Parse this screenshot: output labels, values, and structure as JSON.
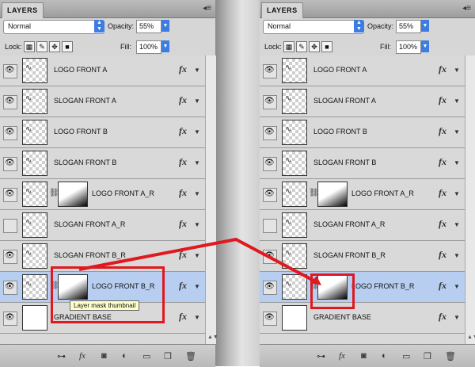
{
  "panel_left": {
    "tab": "LAYERS",
    "blend_mode": "Normal",
    "opacity_label": "Opacity:",
    "opacity_value": "55%",
    "lock_label": "Lock:",
    "fill_label": "Fill:",
    "fill_value": "100%",
    "layers": [
      {
        "name": "LOGO FRONT A",
        "visible": true,
        "mask": false,
        "selected": false,
        "checker": true
      },
      {
        "name": "SLOGAN FRONT A",
        "visible": true,
        "mask": false,
        "selected": false,
        "checker": true
      },
      {
        "name": "LOGO FRONT B",
        "visible": true,
        "mask": false,
        "selected": false,
        "checker": true
      },
      {
        "name": "SLOGAN FRONT B",
        "visible": true,
        "mask": false,
        "selected": false,
        "checker": true
      },
      {
        "name": "LOGO FRONT A_R",
        "visible": true,
        "mask": true,
        "selected": false,
        "checker": true
      },
      {
        "name": "SLOGAN FRONT A_R",
        "visible": false,
        "mask": false,
        "selected": false,
        "checker": true
      },
      {
        "name": "SLOGAN FRONT B_R",
        "visible": true,
        "mask": false,
        "selected": false,
        "checker": true
      },
      {
        "name": "LOGO FRONT B_R",
        "visible": true,
        "mask": true,
        "selected": true,
        "checker": true
      },
      {
        "name": "GRADIENT BASE",
        "visible": true,
        "mask": false,
        "selected": false,
        "checker": false
      }
    ],
    "tooltip": "Layer mask thumbnail"
  },
  "panel_right": {
    "tab": "LAYERS",
    "blend_mode": "Normal",
    "opacity_label": "Opacity:",
    "opacity_value": "55%",
    "lock_label": "Lock:",
    "fill_label": "Fill:",
    "fill_value": "100%",
    "layers": [
      {
        "name": "LOGO FRONT A",
        "visible": true,
        "mask": false,
        "selected": false,
        "checker": true
      },
      {
        "name": "SLOGAN FRONT A",
        "visible": true,
        "mask": false,
        "selected": false,
        "checker": true
      },
      {
        "name": "LOGO FRONT B",
        "visible": true,
        "mask": false,
        "selected": false,
        "checker": true
      },
      {
        "name": "SLOGAN FRONT B",
        "visible": true,
        "mask": false,
        "selected": false,
        "checker": true
      },
      {
        "name": "LOGO FRONT A_R",
        "visible": true,
        "mask": true,
        "selected": false,
        "checker": true
      },
      {
        "name": "SLOGAN FRONT A_R",
        "visible": false,
        "mask": false,
        "selected": false,
        "checker": true
      },
      {
        "name": "SLOGAN FRONT B_R",
        "visible": true,
        "mask": false,
        "selected": false,
        "checker": true
      },
      {
        "name": "LOGO FRONT B_R",
        "visible": true,
        "mask": true,
        "selected": true,
        "checker": true
      },
      {
        "name": "GRADIENT BASE",
        "visible": true,
        "mask": false,
        "selected": false,
        "checker": false
      }
    ]
  },
  "icons": {
    "eye": "eye-icon",
    "fx": "fx",
    "layer_arrow": "disclosure-arrow-icon",
    "bottom": [
      "link-icon",
      "fx-icon",
      "mask-icon",
      "adjustment-icon",
      "folder-icon",
      "new-layer-icon",
      "trash-icon"
    ]
  },
  "colors": {
    "selected_row": "#b7cef0",
    "highlight": "#e0181f",
    "accent": "#3d7ce0"
  }
}
